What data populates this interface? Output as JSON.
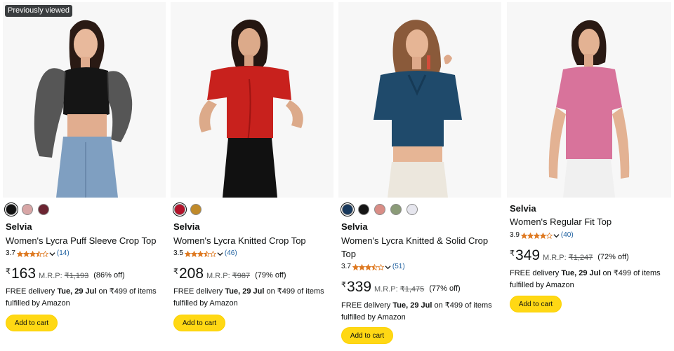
{
  "products": [
    {
      "badge": "Previously viewed",
      "swatches": [
        "#111111",
        "#d8a6a6",
        "#6b2431"
      ],
      "brand": "Selvia",
      "title": "Women's Lycra Puff Sleeve Crop Top",
      "rating": "3.7",
      "stars": 3.5,
      "review_count": "(14)",
      "currency": "₹",
      "price": "163",
      "mrp_label": "M.R.P:",
      "mrp": "₹1,193",
      "discount": "(86% off)",
      "delivery_prefix": "FREE delivery",
      "delivery_date": "Tue, 29 Jul",
      "delivery_suffix": "on ₹499 of items",
      "fulfilled": "fulfilled by Amazon",
      "add_to_cart": "Add to cart",
      "top_color": "#151515"
    },
    {
      "swatches": [
        "#b3122a",
        "#c08a2a"
      ],
      "brand": "Selvia",
      "title": "Women's Lycra Knitted Crop Top",
      "rating": "3.5",
      "stars": 3.5,
      "review_count": "(46)",
      "currency": "₹",
      "price": "208",
      "mrp_label": "M.R.P:",
      "mrp": "₹987",
      "discount": "(79% off)",
      "delivery_prefix": "FREE delivery",
      "delivery_date": "Tue, 29 Jul",
      "delivery_suffix": "on ₹499 of items",
      "fulfilled": "fulfilled by Amazon",
      "add_to_cart": "Add to cart",
      "top_color": "#c8211d"
    },
    {
      "swatches": [
        "#17385c",
        "#151515",
        "#d98d86",
        "#8b9b78",
        "#e6e6ee"
      ],
      "brand": "Selvia",
      "title_line1": "Women's Lycra Knitted & Solid Crop",
      "title_line2": "Top",
      "rating": "3.7",
      "stars": 3.5,
      "review_count": "(51)",
      "currency": "₹",
      "price": "339",
      "mrp_label": "M.R.P:",
      "mrp": "₹1,475",
      "discount": "(77% off)",
      "delivery_prefix": "FREE delivery",
      "delivery_date": "Tue, 29 Jul",
      "delivery_suffix": "on ₹499 of items",
      "fulfilled": "fulfilled by Amazon",
      "add_to_cart": "Add to cart",
      "top_color": "#1f4a6b"
    },
    {
      "brand": "Selvia",
      "title": "Women's Regular Fit Top",
      "rating": "3.9",
      "stars": 4,
      "review_count": "(40)",
      "currency": "₹",
      "price": "349",
      "mrp_label": "M.R.P:",
      "mrp": "₹1,247",
      "discount": "(72% off)",
      "delivery_prefix": "FREE delivery",
      "delivery_date": "Tue, 29 Jul",
      "delivery_suffix": "on ₹499 of items",
      "fulfilled": "fulfilled by Amazon",
      "add_to_cart": "Add to cart",
      "top_color": "#d8739b"
    }
  ],
  "colors": {
    "star": "#DE7921",
    "link": "#2162A1",
    "button": "#FFD814"
  }
}
